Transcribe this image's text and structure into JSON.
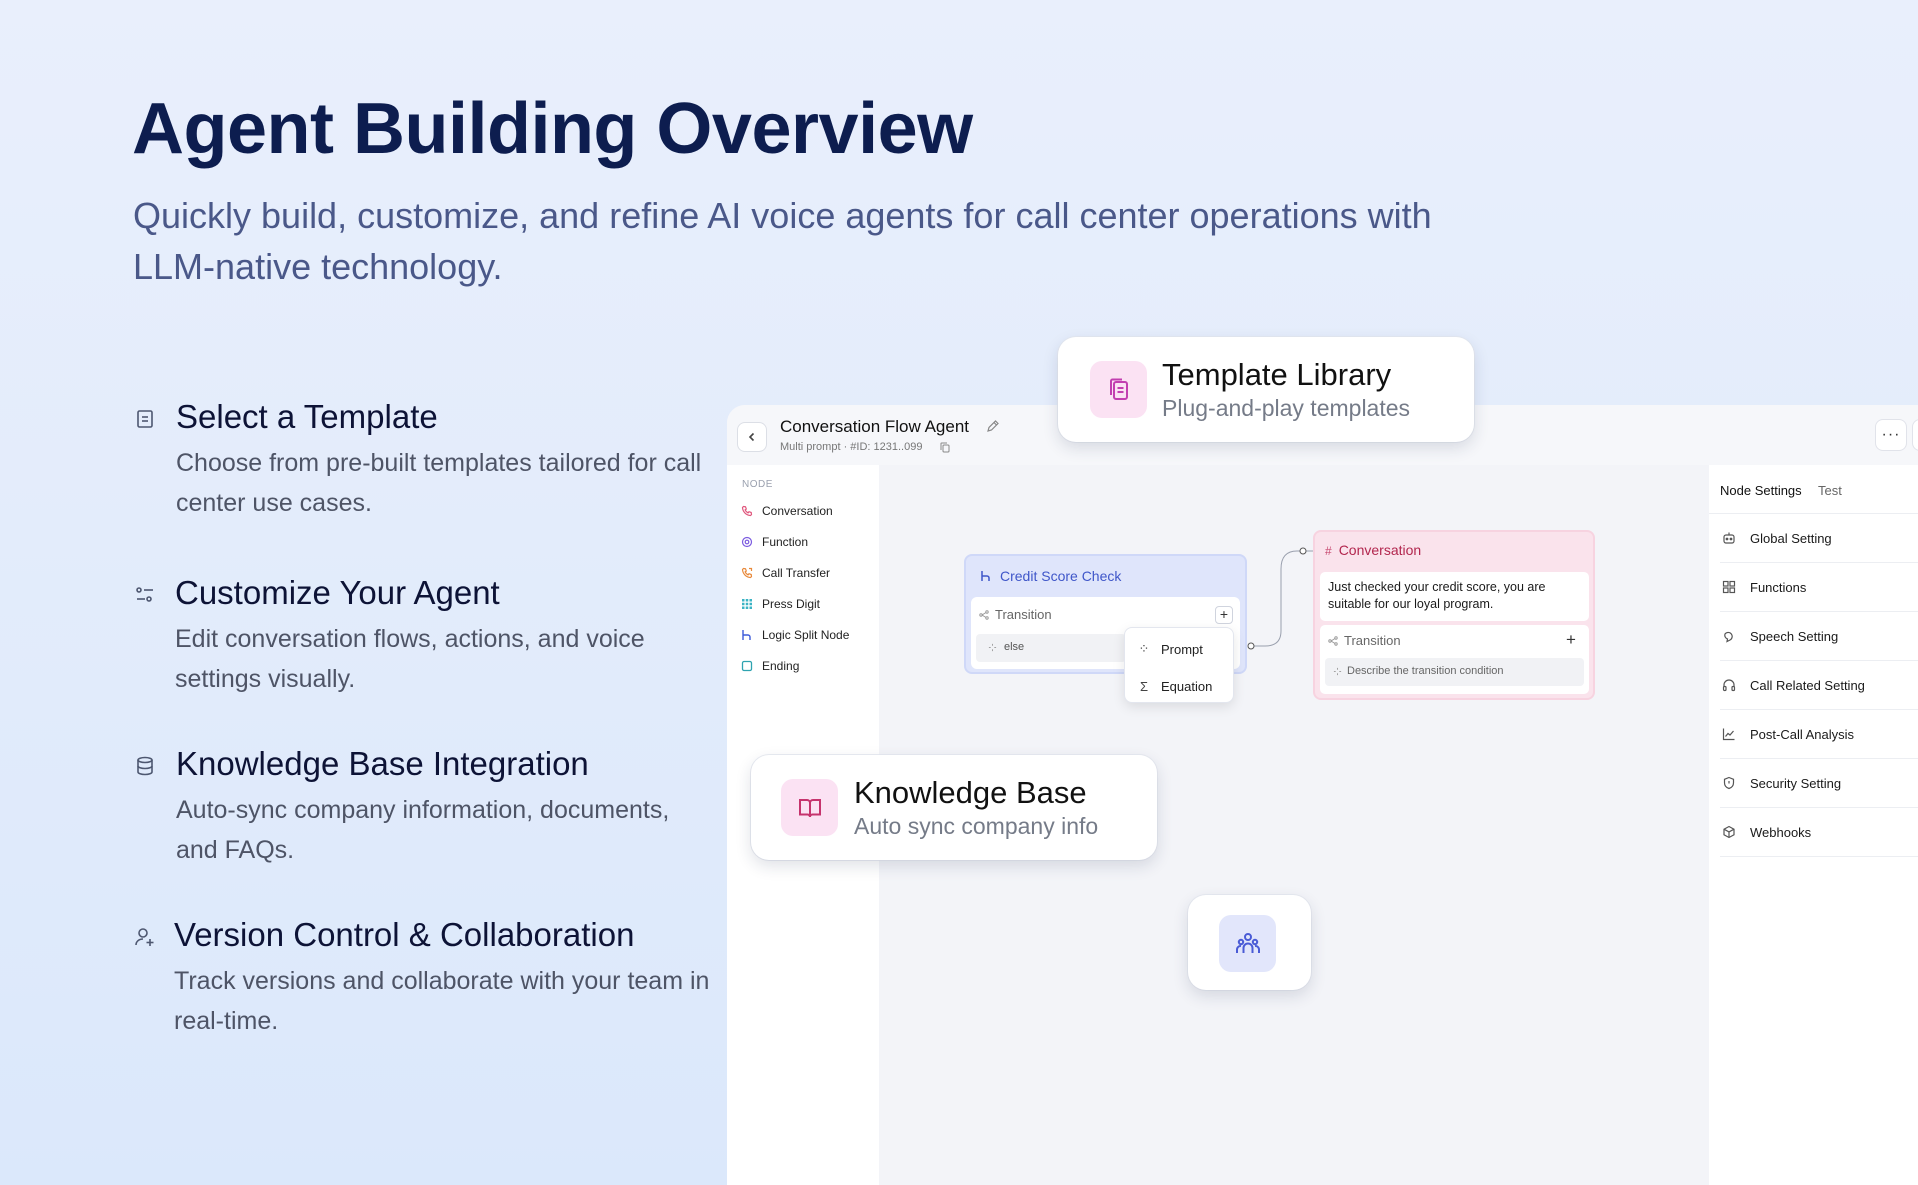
{
  "hero": {
    "title": "Agent Building Overview",
    "subtitle": "Quickly build, customize, and refine AI voice agents for call center operations with LLM-native technology."
  },
  "features": [
    {
      "icon": "document-icon",
      "title": "Select a Template",
      "description": "Choose from pre-built templates tailored for call center use cases."
    },
    {
      "icon": "sliders-icon",
      "title": "Customize Your Agent",
      "description": "Edit conversation flows, actions, and voice settings visually."
    },
    {
      "icon": "database-icon",
      "title": "Knowledge Base Integration",
      "description": "Auto-sync company information, documents, and FAQs."
    },
    {
      "icon": "user-plus-icon",
      "title": "Version Control & Collaboration",
      "description": "Track versions and collaborate with your team in real-time."
    }
  ],
  "app": {
    "title": "Conversation Flow Agent",
    "meta": "Multi prompt · #ID: 1231..099",
    "more": "···",
    "node_header": "NODE",
    "nodes": [
      {
        "label": "Conversation",
        "icon": "phone-icon",
        "color": "#e0577d"
      },
      {
        "label": "Function",
        "icon": "function-icon",
        "color": "#7c5ce0"
      },
      {
        "label": "Call Transfer",
        "icon": "call-transfer-icon",
        "color": "#e8893a"
      },
      {
        "label": "Press Digit",
        "icon": "grid-icon",
        "color": "#3bb3c4"
      },
      {
        "label": "Logic Split Node",
        "icon": "split-icon",
        "color": "#3d5bd9"
      },
      {
        "label": "Ending",
        "icon": "square-icon",
        "color": "#2fa3b0"
      }
    ],
    "right_tabs": {
      "active": "Node Settings",
      "inactive": "Test"
    },
    "settings": [
      {
        "label": "Global Setting",
        "icon": "robot-icon"
      },
      {
        "label": "Functions",
        "icon": "grid-icon"
      },
      {
        "label": "Speech Setting",
        "icon": "speech-icon"
      },
      {
        "label": "Call Related Setting",
        "icon": "headphones-icon"
      },
      {
        "label": "Post-Call Analysis",
        "icon": "chart-icon"
      },
      {
        "label": "Security Setting",
        "icon": "shield-icon"
      },
      {
        "label": "Webhooks",
        "icon": "cube-icon"
      }
    ]
  },
  "flow": {
    "credit_card": {
      "title": "Credit Score Check",
      "transition": "Transition",
      "plus": "+",
      "else": "else"
    },
    "dropdown": [
      {
        "label": "Prompt",
        "icon": "⁘"
      },
      {
        "label": "Equation",
        "icon": "Σ"
      }
    ],
    "conversation_card": {
      "title": "Conversation",
      "message": "Just checked your credit score, you are suitable for our loyal program.",
      "transition": "Transition",
      "plus": "+",
      "placeholder": "Describe the transition condition"
    }
  },
  "cards": {
    "template_library": {
      "title": "Template Library",
      "subtitle": "Plug-and-play templates"
    },
    "knowledge_base": {
      "title": "Knowledge Base",
      "subtitle": "Auto sync company info"
    }
  },
  "colors": {
    "brand_dark": "#0d1d4f",
    "accent_blue": "#3f56c9",
    "accent_pink": "#b2264e",
    "card_icon_bg": "#fbe2f3"
  }
}
